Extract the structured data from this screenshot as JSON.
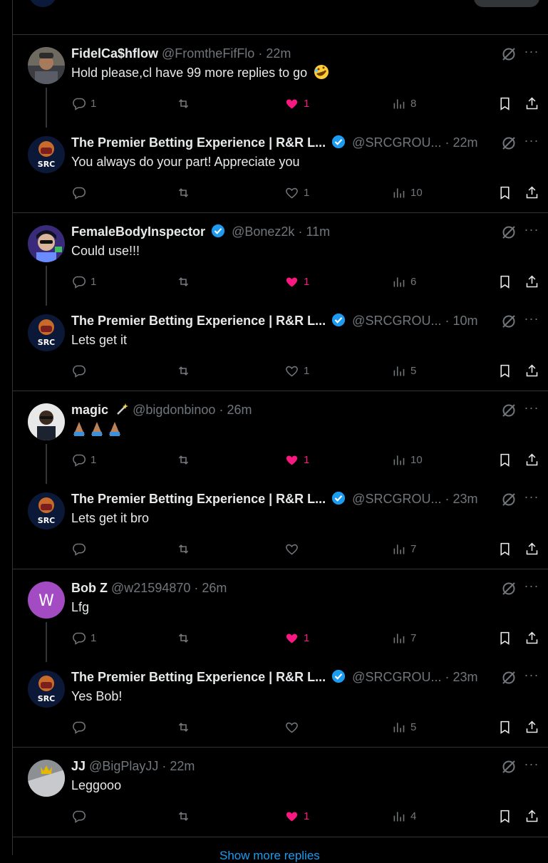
{
  "colors": {
    "background": "#000000",
    "divider": "#2f3336",
    "muted": "#71767b",
    "like": "#f91880",
    "verified": "#1d9bf0",
    "link": "#1d9bf0"
  },
  "more_replies_label": "Show more replies",
  "threads": [
    {
      "reply": {
        "name": "FidelCa$hflow",
        "handle": "@FromtheFifFlo",
        "time": "22m",
        "verified": false,
        "text": "Hold please,cl have 99 more replies to go",
        "emoji": "rolling-on-floor-laughing",
        "avatar": "photo-avatar",
        "replies": "1",
        "likes": "1",
        "liked": true,
        "views": "8"
      },
      "answer": {
        "name": "The Premier Betting Experience | R&R L...",
        "handle": "@SRCGROU...",
        "time": "22m",
        "verified": true,
        "text": "You always do your part!  Appreciate you",
        "avatar_text": "SRC",
        "replies": "",
        "likes": "1",
        "liked": false,
        "views": "10"
      }
    },
    {
      "reply": {
        "name": "FemaleBodyInspector",
        "handle": "@Bonez2k",
        "time": "11m",
        "verified": true,
        "text": "Could use!!!",
        "avatar": "cartoon-avatar",
        "replies": "1",
        "likes": "1",
        "liked": true,
        "views": "6"
      },
      "answer": {
        "name": "The Premier Betting Experience | R&R L...",
        "handle": "@SRCGROU...",
        "time": "10m",
        "verified": true,
        "text": "Lets get it",
        "avatar_text": "SRC",
        "replies": "",
        "likes": "1",
        "liked": false,
        "views": "5"
      }
    },
    {
      "reply": {
        "name": "magic",
        "handle": "@bigdonbinoo",
        "time": "26m",
        "verified": false,
        "text": "",
        "emoji": "folded-hands x3",
        "avatar": "photo-avatar",
        "replies": "1",
        "likes": "1",
        "liked": true,
        "views": "10"
      },
      "answer": {
        "name": "The Premier Betting Experience | R&R L...",
        "handle": "@SRCGROU...",
        "time": "23m",
        "verified": true,
        "text": "Lets get it bro",
        "avatar_text": "SRC",
        "replies": "",
        "likes": "",
        "liked": false,
        "views": "7"
      }
    },
    {
      "reply": {
        "name": "Bob Z",
        "handle": "@w21594870",
        "time": "26m",
        "verified": false,
        "text": "Lfg",
        "avatar_letter": "W",
        "replies": "1",
        "likes": "1",
        "liked": true,
        "views": "7"
      },
      "answer": {
        "name": "The Premier Betting Experience | R&R L...",
        "handle": "@SRCGROU...",
        "time": "23m",
        "verified": true,
        "text": "Yes Bob!",
        "avatar_text": "SRC",
        "replies": "",
        "likes": "",
        "liked": false,
        "views": "5"
      }
    }
  ],
  "last": {
    "name": "JJ",
    "handle": "@BigPlayJJ",
    "time": "22m",
    "verified": false,
    "text": "Leggooo",
    "avatar": "photo-avatar",
    "replies": "",
    "likes": "1",
    "liked": true,
    "views": "4"
  }
}
